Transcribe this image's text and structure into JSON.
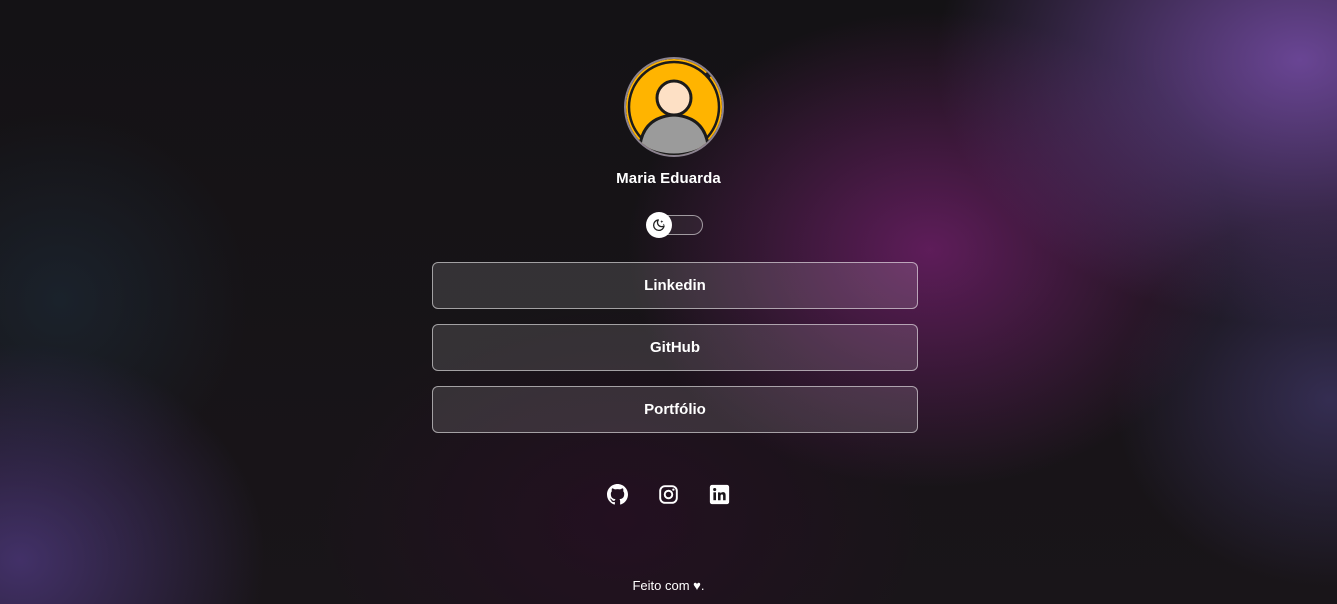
{
  "profile": {
    "name": "Maria Eduarda",
    "avatar_icon": "user-avatar-icon"
  },
  "theme_toggle": {
    "icon": "moon-stars-icon",
    "state": "off"
  },
  "links": [
    {
      "label": "Linkedin"
    },
    {
      "label": "GitHub"
    },
    {
      "label": "Portfólio"
    }
  ],
  "social": [
    {
      "icon": "github-icon"
    },
    {
      "icon": "instagram-icon"
    },
    {
      "icon": "linkedin-icon"
    }
  ],
  "footer": {
    "text": "Feito com ♥."
  },
  "colors": {
    "avatar_background": "#ffb400",
    "accent_purple": "#6a2a78",
    "text": "#ffffff"
  }
}
